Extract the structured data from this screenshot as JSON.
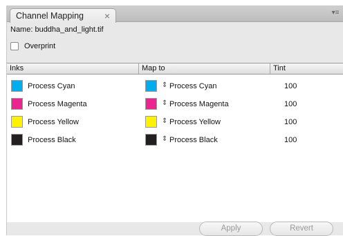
{
  "panel": {
    "tab_title": "Channel Mapping",
    "tab_close": "×",
    "menu_glyph": "▾≡",
    "collapse_glyph": "– –"
  },
  "name_line": "Name: buddha_and_light.tif",
  "overprint": {
    "label": "Overprint",
    "checked": false
  },
  "table": {
    "headers": {
      "inks": "Inks",
      "map_to": "Map to",
      "tint": "Tint"
    },
    "rows": [
      {
        "ink": "Process Cyan",
        "ink_color": "#00aeef",
        "map_arrow": "⇕",
        "map_to": "Process Cyan",
        "map_color": "#00aeef",
        "tint": "100"
      },
      {
        "ink": "Process Magenta",
        "ink_color": "#ec248f",
        "map_arrow": "⇕",
        "map_to": "Process Magenta",
        "map_color": "#ec248f",
        "tint": "100"
      },
      {
        "ink": "Process Yellow",
        "ink_color": "#fff200",
        "map_arrow": "⇕",
        "map_to": "Process Yellow",
        "map_color": "#fff200",
        "tint": "100"
      },
      {
        "ink": "Process Black",
        "ink_color": "#231f20",
        "map_arrow": "⇕",
        "map_to": "Process Black",
        "map_color": "#231f20",
        "tint": "100"
      }
    ]
  },
  "buttons": {
    "apply": "Apply",
    "revert": "Revert"
  }
}
